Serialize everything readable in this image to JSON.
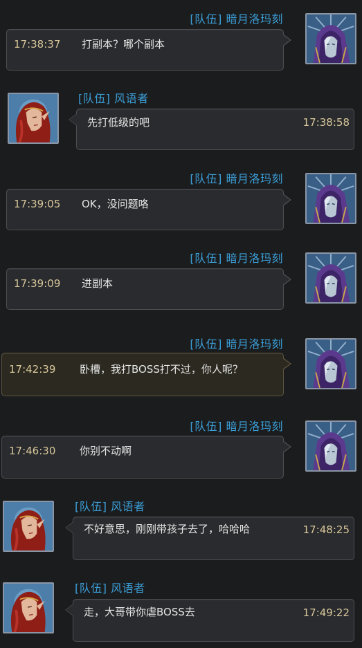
{
  "messages": [
    {
      "sender": "[队伍]  暗月洛玛刻",
      "time": "17:38:37",
      "text": "打副本？哪个副本",
      "avatar": "hooded-mage-avatar"
    },
    {
      "sender": "[队伍]  风语者",
      "time": "17:38:58",
      "text": "先打低级的吧",
      "avatar": "red-haired-elf-avatar"
    },
    {
      "sender": "[队伍]  暗月洛玛刻",
      "time": "17:39:05",
      "text": "OK，没问题咯",
      "avatar": "hooded-mage-avatar"
    },
    {
      "sender": "[队伍]  暗月洛玛刻",
      "time": "17:39:09",
      "text": "进副本",
      "avatar": "hooded-mage-avatar"
    },
    {
      "sender": "[队伍]  暗月洛玛刻",
      "time": "17:42:39",
      "text": "卧槽，我打BOSS打不过，你人呢？",
      "avatar": "hooded-mage-avatar"
    },
    {
      "sender": "[队伍]  暗月洛玛刻",
      "time": "17:46:30",
      "text": "你别不动啊",
      "avatar": "hooded-mage-avatar"
    },
    {
      "sender": "[队伍]  风语者",
      "time": "17:48:25",
      "text": "不好意思，刚刚带孩子去了，哈哈哈",
      "avatar": "red-haired-elf-avatar"
    },
    {
      "sender": "[队伍]  风语者",
      "time": "17:49:22",
      "text": "走，大哥带你虐BOSS去",
      "avatar": "red-haired-elf-avatar"
    }
  ],
  "colors": {
    "channel": "#3b9fd8",
    "timestamp": "#d8c79b",
    "message_text": "#e6e6e6",
    "background": "#1b1c1e"
  }
}
